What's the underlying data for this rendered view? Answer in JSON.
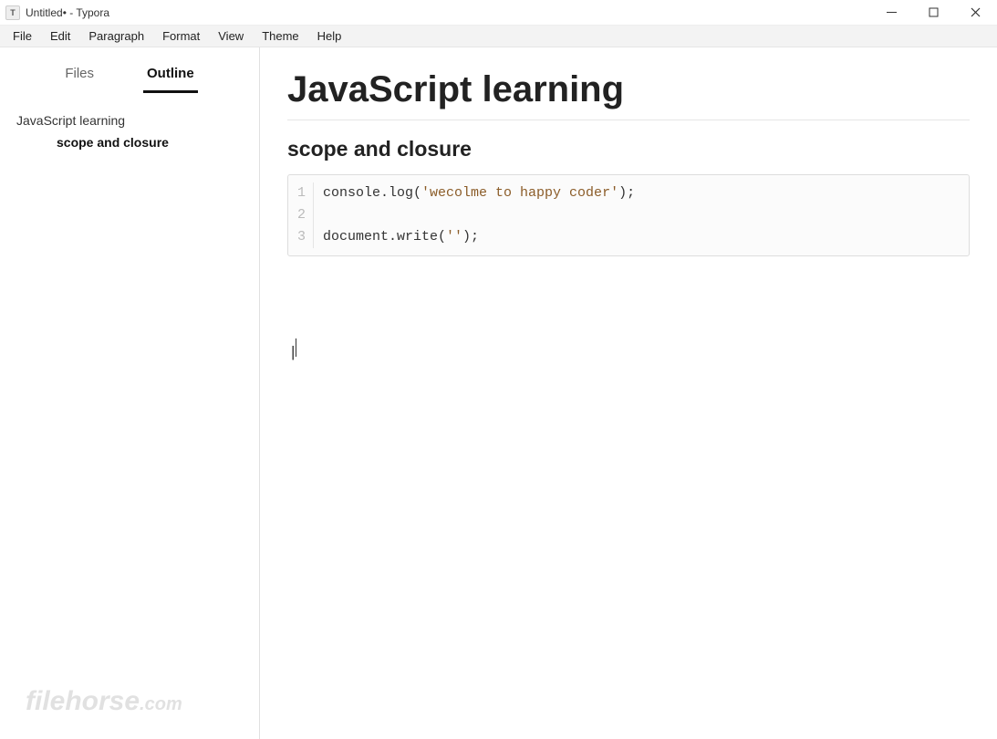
{
  "window": {
    "title": "Untitled• - Typora",
    "app_initial": "T"
  },
  "menubar": [
    "File",
    "Edit",
    "Paragraph",
    "Format",
    "View",
    "Theme",
    "Help"
  ],
  "sidebar": {
    "tabs": {
      "files": "Files",
      "outline": "Outline"
    },
    "outline": {
      "h1": "JavaScript learning",
      "h2": "scope and closure"
    }
  },
  "document": {
    "h1": "JavaScript learning",
    "h2": "scope and closure",
    "code": {
      "lines": [
        {
          "num": "1",
          "parts": [
            "console.log(",
            "'wecolme to happy coder'",
            ");"
          ]
        },
        {
          "num": "2",
          "parts": [
            "",
            "",
            ""
          ]
        },
        {
          "num": "3",
          "parts": [
            "document.write(",
            "''",
            ");"
          ]
        }
      ]
    },
    "cursor_text": "|"
  },
  "watermark": {
    "main": "filehorse",
    "suffix": ".com"
  }
}
